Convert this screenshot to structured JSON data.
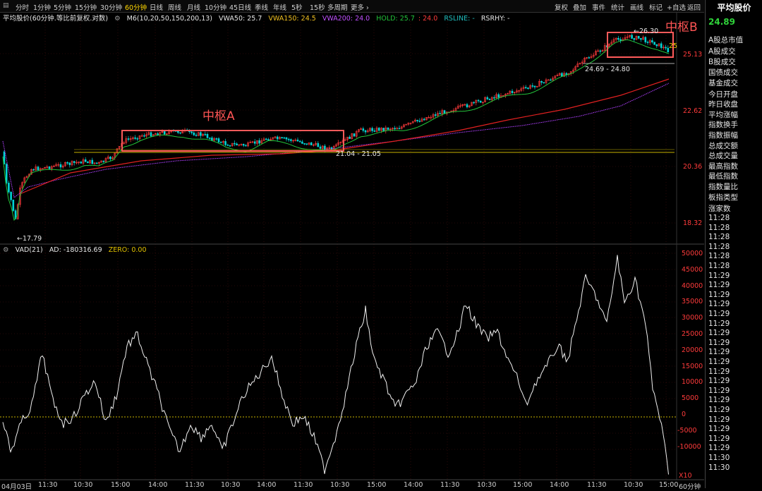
{
  "toolbar": {
    "timeframes": [
      "分时",
      "1分钟",
      "5分钟",
      "15分钟",
      "30分钟",
      "60分钟",
      "日线",
      "周线",
      "月线",
      "10分钟",
      "45日线",
      "季线",
      "年线",
      "5秒",
      "15秒",
      "多周期",
      "更多 ›"
    ],
    "active_timeframe": "60分钟",
    "buttons": [
      "复权",
      "叠加",
      "事件",
      "统计",
      "画线",
      "标记",
      "+自选",
      "返回"
    ]
  },
  "main_indicator": {
    "title": "平均股价(60分钟.等比前复权.对数)",
    "ma": "M6(10,20,50,150,200,13)",
    "vwa50": "VWA50: 25.7",
    "vwa150": "VWA150: 24.5",
    "vwa200": "VWA200: 24.0",
    "hold": "HOLD: 25.7",
    "hold2": ": 24.0",
    "rsline": "RSLINE: -",
    "rsrhy": "RSRHY: -"
  },
  "sub_indicator": {
    "vad": "VAD(21)",
    "ad": "AD: -180316.69",
    "zero": "ZERO: 0.00"
  },
  "sidebar": {
    "title": "平均股价",
    "price": "24.89",
    "items": [
      "A股总市值",
      "A股成交",
      "B股成交",
      "国债成交",
      "基金成交",
      "今日开盘",
      "昨日收盘",
      "平均涨幅",
      "指数换手",
      "指数振幅",
      "总成交额",
      "总成交量",
      "最高指数",
      "最低指数",
      "指数量比",
      "板指类型",
      "涨家数"
    ],
    "times": [
      "11:28",
      "11:28",
      "11:28",
      "11:28",
      "11:28",
      "11:28",
      "11:29",
      "11:29",
      "11:29",
      "11:29",
      "11:29",
      "11:29",
      "11:29",
      "11:29",
      "11:29",
      "11:29",
      "11:29",
      "11:29",
      "11:29",
      "11:29",
      "11:29",
      "11:29",
      "11:29",
      "11:29",
      "11:29",
      "11:30",
      "11:30"
    ]
  },
  "price_axis": [
    "25.13",
    "22.62",
    "20.36",
    "18.32"
  ],
  "vad_axis": [
    "50000",
    "45000",
    "40000",
    "35000",
    "30000",
    "25000",
    "20000",
    "15000",
    "10000",
    "5000",
    "0",
    "-5000",
    "-10000"
  ],
  "zoom_label": "X10",
  "period_label": "60分钟",
  "x_axis": [
    "04月03日",
    "11:30",
    "10:30",
    "15:00",
    "14:00",
    "11:30",
    "10:30",
    "14:00",
    "11:30",
    "10:30",
    "15:00",
    "14:00",
    "11:30",
    "10:30",
    "15:00",
    "14:00",
    "11:30",
    "10:30",
    "15:00"
  ],
  "annotations": {
    "low": "17.79",
    "range_a": "21.04 - 21.05",
    "range_b": "24.69 - 24.80",
    "high": "26.30",
    "right_val": "25",
    "zhongshu_a": "中枢A",
    "zhongshu_b": "中枢B"
  },
  "colors": {
    "up": "#ff3b3b",
    "down": "#00d4d4",
    "ma_green": "#22c33a",
    "ma_red": "#e02020",
    "ma_purple": "#b040ff",
    "zero_line": "#c8b400",
    "highlight_box": "#ff5a5a"
  }
}
